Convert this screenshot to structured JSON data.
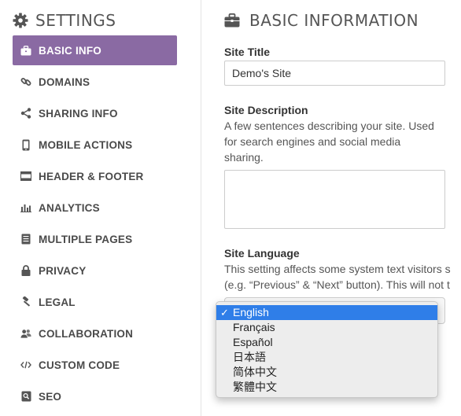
{
  "sidebar": {
    "header": {
      "title": "SETTINGS",
      "icon": "gear-icon"
    },
    "items": [
      {
        "label": "BASIC INFO",
        "icon": "briefcase-icon",
        "active": true
      },
      {
        "label": "DOMAINS",
        "icon": "link-icon"
      },
      {
        "label": "SHARING INFO",
        "icon": "share-icon"
      },
      {
        "label": "MOBILE ACTIONS",
        "icon": "mobile-icon"
      },
      {
        "label": "HEADER & FOOTER",
        "icon": "header-footer-icon"
      },
      {
        "label": "ANALYTICS",
        "icon": "bar-chart-icon"
      },
      {
        "label": "MULTIPLE PAGES",
        "icon": "pages-icon"
      },
      {
        "label": "PRIVACY",
        "icon": "lock-icon"
      },
      {
        "label": "LEGAL",
        "icon": "gavel-icon"
      },
      {
        "label": "COLLABORATION",
        "icon": "users-icon"
      },
      {
        "label": "CUSTOM CODE",
        "icon": "code-icon"
      },
      {
        "label": "SEO",
        "icon": "seo-search-icon"
      }
    ]
  },
  "main": {
    "header": {
      "title": "BASIC INFORMATION",
      "icon": "briefcase-icon"
    },
    "site_title": {
      "label": "Site Title",
      "value": "Demo's Site"
    },
    "site_description": {
      "label": "Site Description",
      "help_lines": [
        "A few sentences describing your site. Used",
        "for search engines and social media",
        "sharing."
      ],
      "value": ""
    },
    "site_language": {
      "label": "Site Language",
      "help_lines": [
        "This setting affects some system text visitors s",
        "(e.g. “Previous” & “Next” button). This will not t"
      ],
      "selected": "English",
      "options": [
        "English",
        "Français",
        "Español",
        "日本語",
        "简体中文",
        "繁體中文"
      ]
    }
  },
  "colors": {
    "accent": "#8a6aa3",
    "selection": "#2f7ee8"
  }
}
